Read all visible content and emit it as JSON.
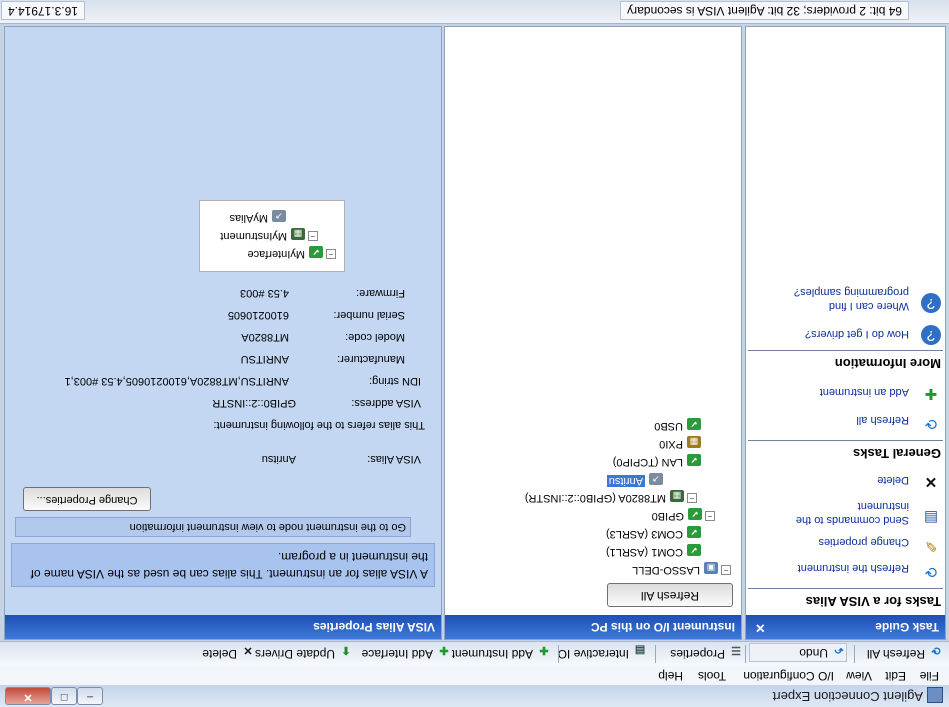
{
  "window": {
    "title": "Agilent Connection Expert"
  },
  "menu": [
    "File",
    "Edit",
    "View",
    "I/O Configuration",
    "Tools",
    "Help"
  ],
  "toolbar": {
    "refresh_all": "Refresh All",
    "undo": "Undo",
    "properties": "Properties",
    "interactive_io": "Interactive IO",
    "add_instrument": "Add Instrument",
    "add_interface": "Add Interface",
    "update_drivers": "Update Drivers",
    "delete": "Delete"
  },
  "task_guide": {
    "header": "Task Guide",
    "close": "×",
    "section1": "Tasks for a VISA Alias",
    "refresh_instrument": "Refresh the instrument",
    "change_properties": "Change properties",
    "send_commands": "Send commands to the instrument",
    "delete": "Delete",
    "section2": "General Tasks",
    "refresh_all": "Refresh all",
    "add_instrument": "Add an instrument",
    "section3": "More Information",
    "get_drivers": "How do I get drivers?",
    "samples": "Where can I find programming samples?"
  },
  "io_panel": {
    "header": "Instrument I/O on this PC",
    "refresh_button": "Refresh All",
    "tree": {
      "root": "LASSO-DELL",
      "com1": "COM1 (ASRL1)",
      "com3": "COM3 (ASRL3)",
      "gpib0": "GPIB0",
      "instrument": "MT8820A (GPIB0::2::INSTR)",
      "alias": "Anritsu",
      "lan": "LAN (TCPIP0)",
      "pxi": "PXI0",
      "usb": "USB0"
    }
  },
  "properties_panel": {
    "header": "VISA Alias Properties",
    "banner": "A VISA alias for an instrument. This alias can be used as the VISA name of the instrument in a program.",
    "goto_text": "Go to the instrument node to view instrument information",
    "change_button": "Change Properties...",
    "alias_label": "VISA Alias:",
    "alias_value": "Anritsu",
    "refers_text": "This alias refers to the following instrument:",
    "fields": [
      {
        "label": "VISA address:",
        "value": "GPIB0::2::INSTR"
      },
      {
        "label": "IDN string:",
        "value": "ANRITSU,MT8820A,6100210605,4.53 #003,1"
      },
      {
        "label": "Manufacturer:",
        "value": "ANRITSU"
      },
      {
        "label": "Model code:",
        "value": "MT8820A"
      },
      {
        "label": "Serial number:",
        "value": "6100210605"
      },
      {
        "label": "Firmware:",
        "value": "4.53 #003"
      }
    ],
    "diagram": {
      "interface": "MyInterface",
      "instrument": "MyInstrument",
      "alias": "MyAlias"
    }
  },
  "status": {
    "left": "64 bit: 2 providers; 32 bit: Agilent VISA is secondary",
    "right": "16.3.17914.4"
  }
}
